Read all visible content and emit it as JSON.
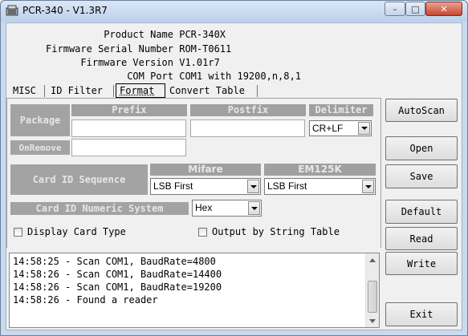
{
  "window": {
    "title": "PCR-340 - V1.3R7",
    "minimize_glyph": "–",
    "maximize_glyph": "□",
    "close_glyph": "✕"
  },
  "info": {
    "rows": [
      {
        "label": "Product Name",
        "value": "PCR-340X"
      },
      {
        "label": "Firmware Serial Number",
        "value": "ROM-T0611"
      },
      {
        "label": "Firmware Version",
        "value": "V1.01r7"
      },
      {
        "label": "COM Port",
        "value": "COM1 with 19200,n,8,1"
      }
    ]
  },
  "tabs": [
    "MISC",
    "ID Filter",
    "Format",
    "Convert Table"
  ],
  "active_tab": "Format",
  "format": {
    "package_label": "Package",
    "prefix_label": "Prefix",
    "postfix_label": "Postfix",
    "delimiter_label": "Delimiter",
    "prefix_value": "",
    "postfix_value": "",
    "delimiter_value": "CR+LF",
    "onremove_label": "OnRemove",
    "onremove_value": "",
    "card_id_sequence_label": "Card ID Sequence",
    "mifare_label": "Mifare",
    "em125k_label": "EM125K",
    "mifare_value": "LSB First",
    "em125k_value": "LSB First",
    "numeric_system_label": "Card ID Numeric System",
    "numeric_system_value": "Hex",
    "display_card_type_label": "Display Card Type",
    "display_card_type_checked": false,
    "output_by_string_table_label": "Output by String Table",
    "output_by_string_table_checked": false
  },
  "buttons": {
    "autoscan": "AutoScan",
    "open": "Open",
    "save": "Save",
    "default": "Default",
    "read": "Read",
    "write": "Write",
    "exit": "Exit"
  },
  "log": [
    "14:58:25 - Scan COM1, BaudRate=4800",
    "14:58:26 - Scan COM1, BaudRate=14400",
    "14:58:26 - Scan COM1, BaudRate=19200",
    "14:58:26 - Found a reader"
  ],
  "colors": {
    "section_header": "#a0a0a0",
    "header_text": "#e8e8e8"
  }
}
